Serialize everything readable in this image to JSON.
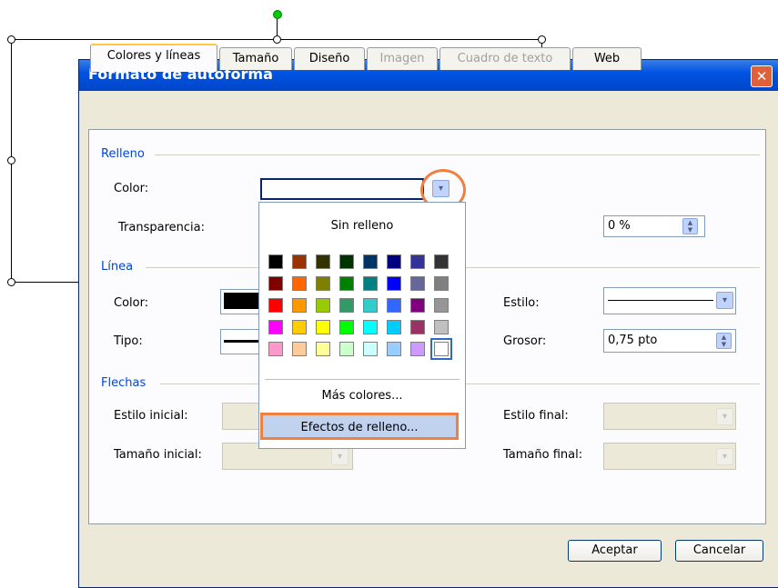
{
  "dialog": {
    "title": "Formato de autoforma",
    "close_label": "✕"
  },
  "tabs": [
    {
      "label": "Colores y líneas",
      "state": "active"
    },
    {
      "label": "Tamaño",
      "state": "enabled"
    },
    {
      "label": "Diseño",
      "state": "enabled"
    },
    {
      "label": "Imagen",
      "state": "disabled"
    },
    {
      "label": "Cuadro de texto",
      "state": "disabled"
    },
    {
      "label": "Web",
      "state": "enabled"
    }
  ],
  "relleno": {
    "group_label": "Relleno",
    "color_label": "Color:",
    "transparency_label": "Transparencia:",
    "transparency_value": "0 %"
  },
  "linea": {
    "group_label": "Línea",
    "color_label": "Color:",
    "type_label": "Tipo:",
    "style_label": "Estilo:",
    "weight_label": "Grosor:",
    "weight_value": "0,75 pto"
  },
  "flechas": {
    "group_label": "Flechas",
    "start_style_label": "Estilo inicial:",
    "start_size_label": "Tamaño inicial:",
    "end_style_label": "Estilo final:",
    "end_size_label": "Tamaño final:"
  },
  "color_popup": {
    "no_fill": "Sin relleno",
    "more_colors": "Más colores...",
    "fill_effects": "Efectos de relleno...",
    "palette": [
      [
        "#000000",
        "#993300",
        "#333300",
        "#003300",
        "#003366",
        "#000080",
        "#333399",
        "#333333"
      ],
      [
        "#800000",
        "#ff6600",
        "#808000",
        "#008000",
        "#008080",
        "#0000ff",
        "#666699",
        "#808080"
      ],
      [
        "#ff0000",
        "#ff9900",
        "#99cc00",
        "#339966",
        "#33cccc",
        "#3366ff",
        "#800080",
        "#969696"
      ],
      [
        "#ff00ff",
        "#ffcc00",
        "#ffff00",
        "#00ff00",
        "#00ffff",
        "#00ccff",
        "#993366",
        "#c0c0c0"
      ],
      [
        "#ff99cc",
        "#ffcc99",
        "#ffff99",
        "#ccffcc",
        "#ccffff",
        "#99ccff",
        "#cc99ff",
        "#ffffff"
      ]
    ],
    "highlight_color": "#f08040"
  },
  "buttons": {
    "ok": "Aceptar",
    "cancel": "Cancelar"
  }
}
